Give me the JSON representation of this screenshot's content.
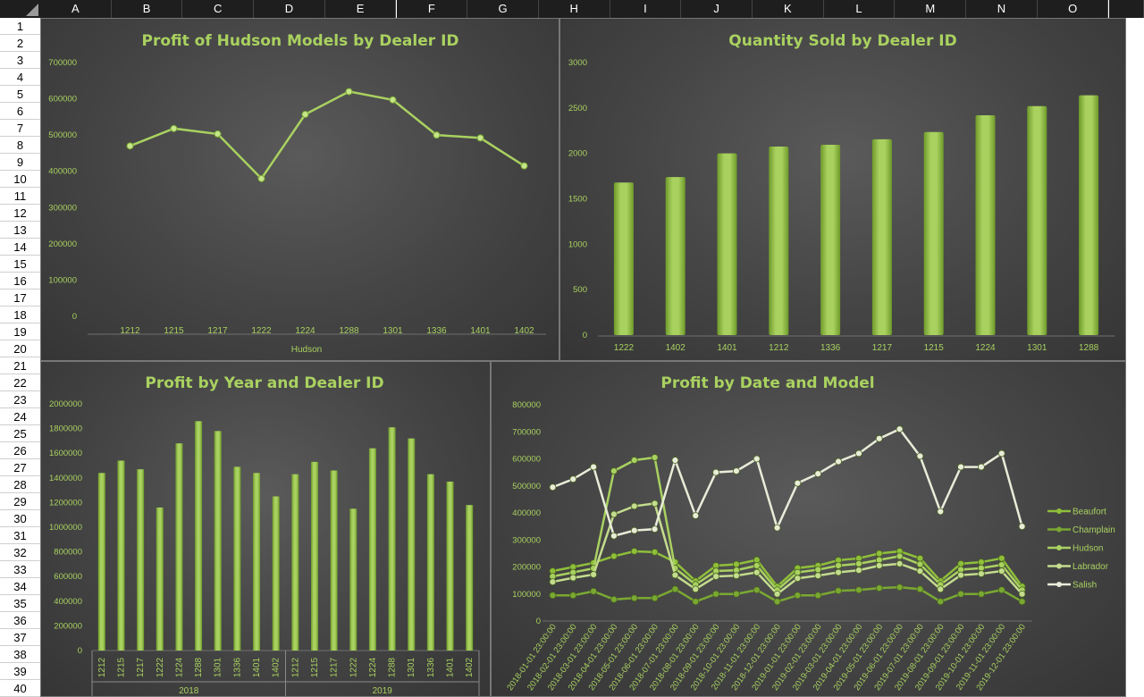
{
  "spreadsheet": {
    "columns": [
      "A",
      "B",
      "C",
      "D",
      "E",
      "F",
      "G",
      "H",
      "I",
      "J",
      "K",
      "L",
      "M",
      "N",
      "O"
    ],
    "rows": [
      "1",
      "2",
      "3",
      "4",
      "5",
      "6",
      "7",
      "8",
      "9",
      "10",
      "11",
      "12",
      "13",
      "14",
      "15",
      "16",
      "17",
      "18",
      "19",
      "20",
      "21",
      "22",
      "23",
      "24",
      "25",
      "26",
      "27",
      "28",
      "29",
      "30",
      "31",
      "32",
      "33",
      "34",
      "35",
      "36",
      "37",
      "38",
      "39",
      "40"
    ]
  },
  "colors": {
    "accent": "#a9d160",
    "bar": "#8fbf3a",
    "salish": "#e8ecd8",
    "background": "#444444"
  },
  "chart_data": [
    {
      "type": "line",
      "title": "Profit of Hudson Models by Dealer ID",
      "xlabel": "Hudson",
      "categories": [
        "1212",
        "1215",
        "1217",
        "1222",
        "1224",
        "1288",
        "1301",
        "1336",
        "1401",
        "1402"
      ],
      "values": [
        470000,
        518000,
        503000,
        380000,
        557000,
        620000,
        597000,
        500000,
        492000,
        415000
      ],
      "yticks": [
        "700000",
        "600000",
        "500000",
        "400000",
        "300000",
        "200000",
        "100000",
        "0"
      ],
      "ylim": [
        0,
        700000
      ],
      "grid": false
    },
    {
      "type": "bar",
      "title": "Quantity Sold by Dealer ID",
      "categories": [
        "1222",
        "1402",
        "1401",
        "1212",
        "1336",
        "1217",
        "1215",
        "1224",
        "1301",
        "1288"
      ],
      "values": [
        1680,
        1740,
        2000,
        2075,
        2095,
        2155,
        2235,
        2420,
        2520,
        2640
      ],
      "yticks": [
        "3000",
        "2500",
        "2000",
        "1500",
        "1000",
        "500",
        "0"
      ],
      "ylim": [
        0,
        3000
      ],
      "grid": false
    },
    {
      "type": "bar",
      "title": "Profit by Year and Dealer ID",
      "groups": [
        {
          "label": "2018",
          "categories": [
            "1212",
            "1215",
            "1217",
            "1222",
            "1224",
            "1288",
            "1301",
            "1336",
            "1401",
            "1402"
          ],
          "values": [
            1440000,
            1540000,
            1470000,
            1160000,
            1680000,
            1860000,
            1780000,
            1490000,
            1440000,
            1250000
          ]
        },
        {
          "label": "2019",
          "categories": [
            "1212",
            "1215",
            "1217",
            "1222",
            "1224",
            "1288",
            "1301",
            "1336",
            "1401",
            "1402"
          ],
          "values": [
            1430000,
            1530000,
            1460000,
            1150000,
            1640000,
            1810000,
            1720000,
            1430000,
            1370000,
            1180000
          ]
        }
      ],
      "yticks": [
        "2000000",
        "1800000",
        "1600000",
        "1400000",
        "1200000",
        "1000000",
        "800000",
        "600000",
        "400000",
        "200000",
        "0"
      ],
      "ylim": [
        0,
        2000000
      ],
      "grid": false
    },
    {
      "type": "line",
      "title": "Profit by Date and Model",
      "categories": [
        "2018-01-01 23:00:00",
        "2018-02-01 23:00:00",
        "2018-03-01 23:00:00",
        "2018-04-01 23:00:00",
        "2018-05-01 23:00:00",
        "2018-06-01 23:00:00",
        "2018-07-01 23:00:00",
        "2018-08-01 23:00:00",
        "2018-09-01 23:00:00",
        "2018-10-01 23:00:00",
        "2018-11-01 23:00:00",
        "2018-12-01 23:00:00",
        "2019-01-01 23:00:00",
        "2019-02-01 23:00:00",
        "2019-03-01 23:00:00",
        "2019-04-01 23:00:00",
        "2019-05-01 23:00:00",
        "2019-06-01 23:00:00",
        "2019-07-01 23:00:00",
        "2019-08-01 23:00:00",
        "2019-09-01 23:00:00",
        "2019-10-01 23:00:00",
        "2019-11-01 23:00:00",
        "2019-12-01 23:00:00"
      ],
      "series": [
        {
          "name": "Beaufort",
          "color": "#8fbf3a",
          "values": [
            185000,
            200000,
            215000,
            240000,
            258000,
            255000,
            218000,
            148000,
            205000,
            210000,
            226000,
            128000,
            196000,
            205000,
            225000,
            232000,
            250000,
            258000,
            232000,
            148000,
            212000,
            218000,
            232000,
            128000
          ]
        },
        {
          "name": "Champlain",
          "color": "#7aa832",
          "values": [
            95000,
            95000,
            110000,
            80000,
            85000,
            85000,
            118000,
            72000,
            100000,
            100000,
            115000,
            72000,
            95000,
            95000,
            112000,
            115000,
            122000,
            125000,
            118000,
            72000,
            100000,
            100000,
            115000,
            72000
          ]
        },
        {
          "name": "Hudson",
          "color": "#a9d160",
          "values": [
            165000,
            180000,
            195000,
            555000,
            595000,
            605000,
            195000,
            135000,
            185000,
            188000,
            205000,
            115000,
            180000,
            190000,
            205000,
            212000,
            226000,
            240000,
            210000,
            135000,
            190000,
            196000,
            208000,
            115000
          ]
        },
        {
          "name": "Labrador",
          "color": "#c4dc8e",
          "values": [
            145000,
            160000,
            172000,
            395000,
            425000,
            435000,
            170000,
            118000,
            165000,
            168000,
            180000,
            100000,
            158000,
            168000,
            180000,
            188000,
            205000,
            212000,
            185000,
            118000,
            170000,
            175000,
            185000,
            100000
          ]
        },
        {
          "name": "Salish",
          "color": "#e8ecd8",
          "values": [
            495000,
            525000,
            570000,
            315000,
            335000,
            340000,
            595000,
            390000,
            550000,
            555000,
            600000,
            345000,
            510000,
            545000,
            590000,
            620000,
            675000,
            710000,
            610000,
            405000,
            570000,
            570000,
            620000,
            350000
          ]
        }
      ],
      "yticks": [
        "800000",
        "700000",
        "600000",
        "500000",
        "400000",
        "300000",
        "200000",
        "100000",
        "0"
      ],
      "ylim": [
        0,
        800000
      ],
      "legend": "right",
      "grid": false
    }
  ]
}
